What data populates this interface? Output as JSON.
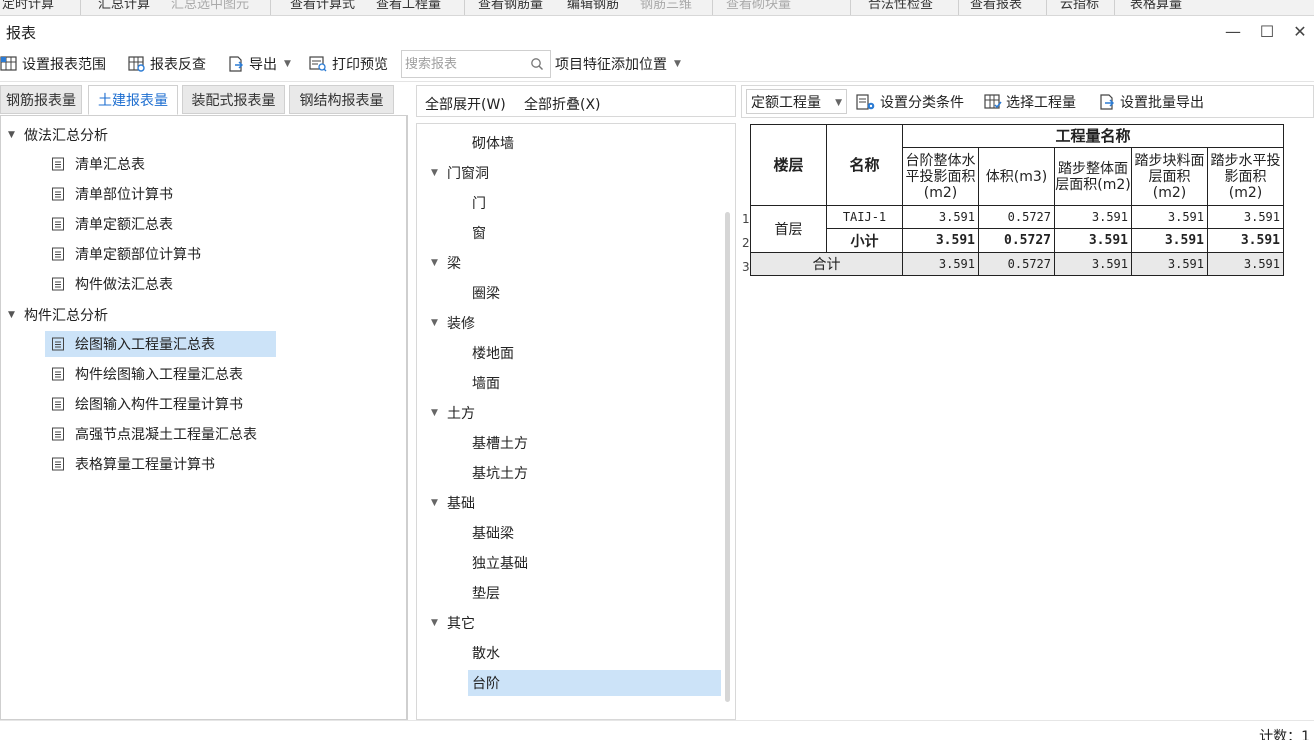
{
  "top_strip": {
    "items": [
      "定时计算",
      "汇总计算",
      "汇总选中图元",
      "查看计算式",
      "查看工程量",
      "查看钢筋量",
      "编辑钢筋",
      "钢筋三维",
      "查看砌块量",
      "合法性检查",
      "查看报表",
      "云指标",
      "表格算量"
    ]
  },
  "window": {
    "title": "报表",
    "minimize": "—",
    "maximize": "☐",
    "close": "✕"
  },
  "toolbar": {
    "set_range": "设置报表范围",
    "reverse_check": "报表反查",
    "export": "导出",
    "print_preview": "打印预览",
    "search_placeholder": "搜索报表",
    "add_position": "项目特征添加位置"
  },
  "left": {
    "tabs": [
      "钢筋报表量",
      "土建报表量",
      "装配式报表量",
      "钢结构报表量"
    ],
    "active_tab": "土建报表量",
    "groups": [
      {
        "label": "做法汇总分析",
        "items": [
          "清单汇总表",
          "清单部位计算书",
          "清单定额汇总表",
          "清单定额部位计算书",
          "构件做法汇总表"
        ]
      },
      {
        "label": "构件汇总分析",
        "items": [
          "绘图输入工程量汇总表",
          "构件绘图输入工程量汇总表",
          "绘图输入构件工程量计算书",
          "高强节点混凝土工程量汇总表",
          "表格算量工程量计算书"
        ]
      }
    ],
    "selected_item": "绘图输入工程量汇总表"
  },
  "middle": {
    "expand_all": "全部展开(W)",
    "collapse_all": "全部折叠(X)",
    "tree": [
      {
        "type": "item",
        "label": "砌体墙"
      },
      {
        "type": "group",
        "label": "门窗洞"
      },
      {
        "type": "item",
        "label": "门"
      },
      {
        "type": "item",
        "label": "窗"
      },
      {
        "type": "group",
        "label": "梁"
      },
      {
        "type": "item",
        "label": "圈梁"
      },
      {
        "type": "group",
        "label": "装修"
      },
      {
        "type": "item",
        "label": "楼地面"
      },
      {
        "type": "item",
        "label": "墙面"
      },
      {
        "type": "group",
        "label": "土方"
      },
      {
        "type": "item",
        "label": "基槽土方"
      },
      {
        "type": "item",
        "label": "基坑土方"
      },
      {
        "type": "group",
        "label": "基础"
      },
      {
        "type": "item",
        "label": "基础梁"
      },
      {
        "type": "item",
        "label": "独立基础"
      },
      {
        "type": "item",
        "label": "垫层"
      },
      {
        "type": "group",
        "label": "其它"
      },
      {
        "type": "item",
        "label": "散水"
      },
      {
        "type": "item",
        "label": "台阶"
      }
    ],
    "selected": "台阶"
  },
  "right": {
    "dropdown": "定额工程量",
    "set_classify": "设置分类条件",
    "select_qty": "选择工程量",
    "batch_export": "设置批量导出",
    "table": {
      "header_floor": "楼层",
      "header_name": "名称",
      "header_group": "工程量名称",
      "columns": [
        "台阶整体水平投影面积(m2)",
        "体积(m3)",
        "踏步整体面层面积(m2)",
        "踏步块料面层面积(m2)",
        "踏步水平投影面积(m2)"
      ],
      "row_numbers": [
        "1",
        "2",
        "3"
      ],
      "floor": "首层",
      "rows": [
        {
          "name": "TAIJ-1",
          "values": [
            "3.591",
            "0.5727",
            "3.591",
            "3.591",
            "3.591"
          ]
        },
        {
          "name": "小计",
          "values": [
            "3.591",
            "0.5727",
            "3.591",
            "3.591",
            "3.591"
          ]
        }
      ],
      "total_label": "合计",
      "total_values": [
        "3.591",
        "0.5727",
        "3.591",
        "3.591",
        "3.591"
      ]
    }
  },
  "status": {
    "count": "计数：1"
  }
}
